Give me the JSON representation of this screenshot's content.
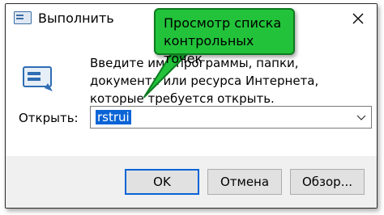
{
  "window": {
    "title": "Выполнить"
  },
  "dialog": {
    "description": "Введите имя программы, папки, документа или ресурса Интернета, которые требуется открыть.",
    "open_label": "Открыть:",
    "open_value": "rstrui"
  },
  "buttons": {
    "ok": "OK",
    "cancel": "Отмена",
    "browse": "Обзор..."
  },
  "annotation": {
    "text": "Просмотр списка контрольных точек",
    "color": "#22c33a"
  },
  "icons": {
    "app": "run-icon",
    "close": "close-icon",
    "dropdown": "chevron-down-icon"
  }
}
